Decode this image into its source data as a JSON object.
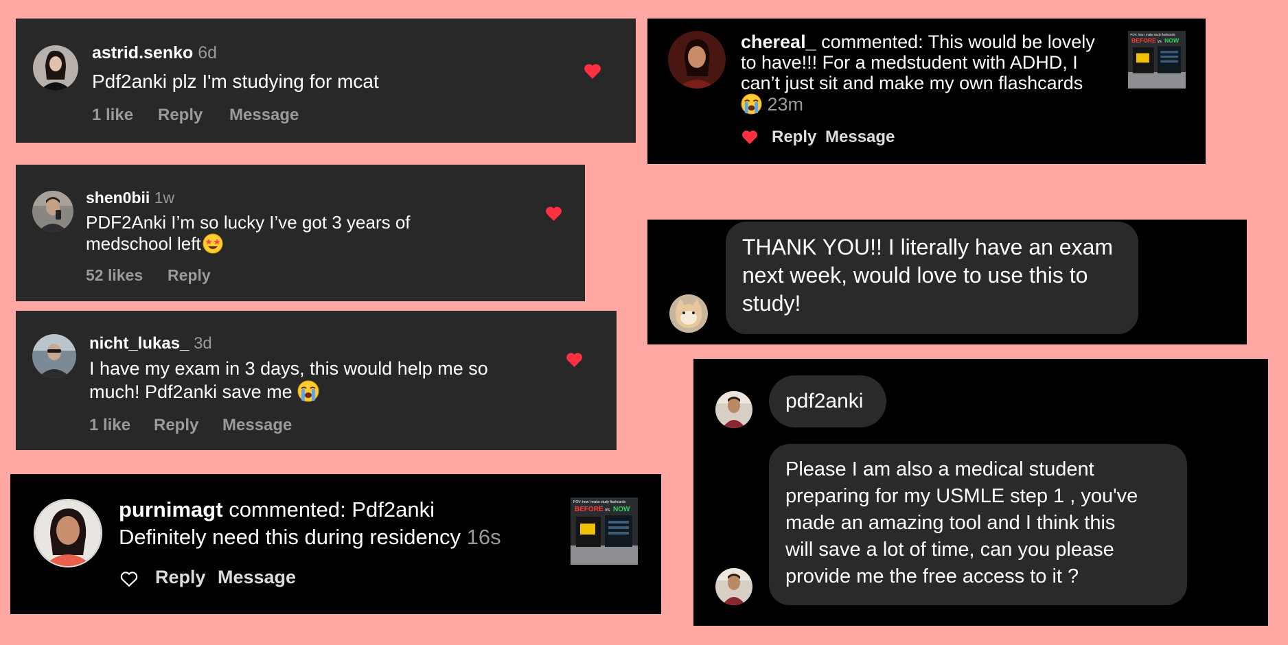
{
  "colors": {
    "background": "#ffa7a2",
    "card_gray": "#282828",
    "card_black": "#000000",
    "heart_red": "#ff3040",
    "muted_text": "#9a9a9a",
    "bubble": "#2a2a2a"
  },
  "comment1": {
    "username": "astrid.senko",
    "time": "6d",
    "text": "Pdf2anki plz I'm studying for mcat",
    "likes": "1 like",
    "reply": "Reply",
    "message": "Message",
    "liked": true
  },
  "comment2": {
    "username": "shen0bii",
    "time": "1w",
    "text_line1": "PDF2Anki I’m so lucky I’ve got 3 years of",
    "text_line2": "medschool left",
    "likes": "52 likes",
    "reply": "Reply",
    "liked": true
  },
  "comment3": {
    "username": "nicht_lukas_",
    "time": "3d",
    "text_line1": "I have my exam in 3 days, this would help me so",
    "text_line2": "much! Pdf2anki save me",
    "likes": "1 like",
    "reply": "Reply",
    "message": "Message",
    "liked": true
  },
  "comment4": {
    "username": "purnimagt",
    "commented": "commented: Pdf2anki",
    "text_line2": "Definitely need this during residency",
    "time": "16s",
    "reply": "Reply",
    "message": "Message",
    "liked": false,
    "thumb_caption": "POV: how I make study flashcards",
    "thumb_before": "BEFORE",
    "thumb_vs": "vs",
    "thumb_now": "NOW"
  },
  "comment5": {
    "username": "chereal_",
    "line1_rest": "commented: This would be lovely",
    "line2": "to have!!! For a medstudent with ADHD, I",
    "line3": "can’t just sit and make my own flashcards",
    "time": "23m",
    "reply": "Reply",
    "message": "Message",
    "liked": true,
    "thumb_caption": "POV: how I make study flashcards",
    "thumb_before": "BEFORE",
    "thumb_vs": "vs",
    "thumb_now": "NOW"
  },
  "dm1": {
    "line1": "THANK YOU!! I literally have an exam",
    "line2": "next week, would love to use this to",
    "line3": "study!"
  },
  "dm2": {
    "name_bubble": "pdf2anki",
    "line1": "Please I am also a medical student",
    "line2": "preparing for my USMLE step 1 , you've",
    "line3": "made an amazing tool and I think this",
    "line4": "will save a lot of time, can you please",
    "line5": "provide me the free access to it ?"
  }
}
